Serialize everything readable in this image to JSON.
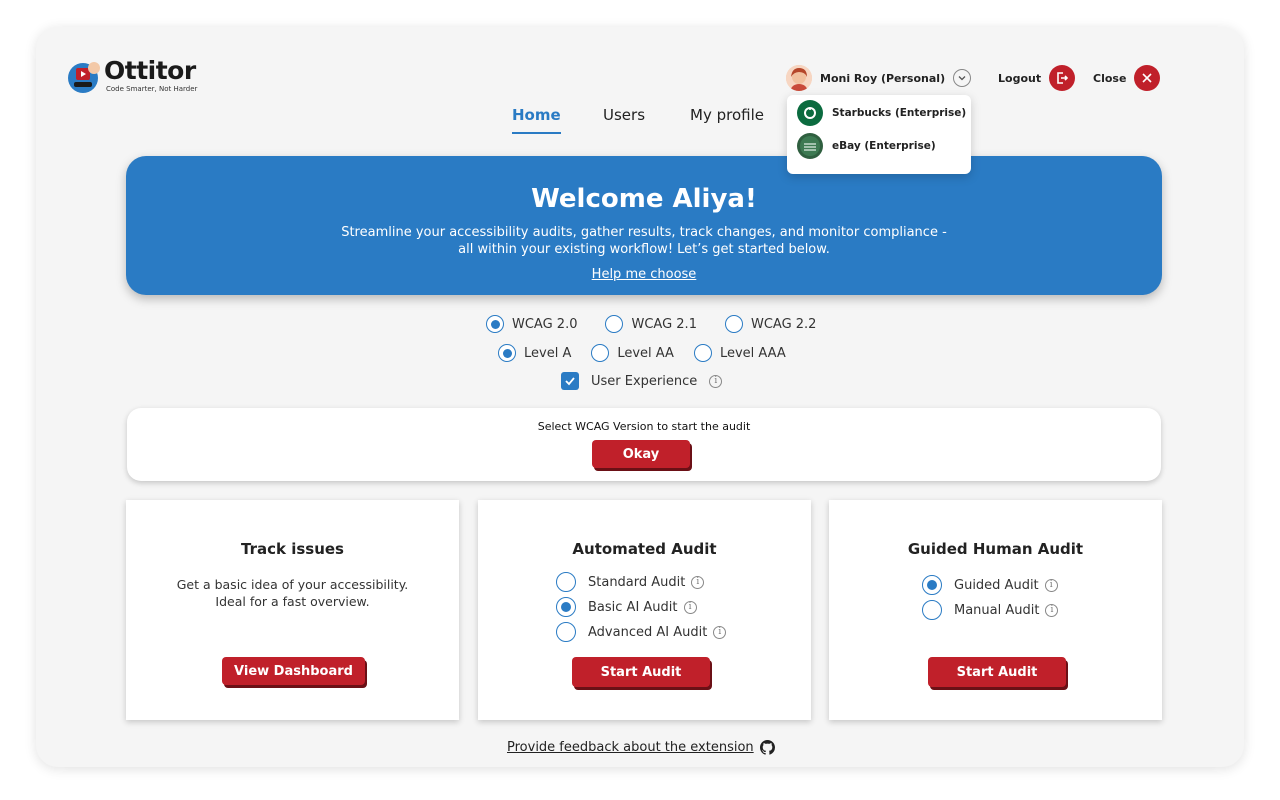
{
  "brand": {
    "name": "Ottitor",
    "tagline": "Code Smarter, Not Harder"
  },
  "header": {
    "account": {
      "name": "Moni Roy (Personal)"
    },
    "logout_label": "Logout",
    "close_label": "Close"
  },
  "nav": {
    "home": "Home",
    "users": "Users",
    "my_profile": "My profile",
    "active": "Home"
  },
  "account_dropdown": {
    "items": [
      {
        "label": "Starbucks (Enterprise)"
      },
      {
        "label": "eBay (Enterprise)"
      }
    ]
  },
  "banner": {
    "title": "Welcome Aliya!",
    "line1": "Streamline your accessibility audits, gather results, track changes, and monitor compliance -",
    "line2": "all within your existing workflow! Let’s get started below.",
    "help_link": "Help me choose"
  },
  "wcag": {
    "versions": [
      {
        "label": "WCAG 2.0",
        "selected": true
      },
      {
        "label": "WCAG 2.1",
        "selected": false
      },
      {
        "label": "WCAG 2.2",
        "selected": false
      }
    ],
    "levels": [
      {
        "label": "Level A",
        "selected": true
      },
      {
        "label": "Level AA",
        "selected": false
      },
      {
        "label": "Level AAA",
        "selected": false
      }
    ],
    "user_experience": {
      "label": "User Experience",
      "checked": true
    }
  },
  "prompt": {
    "message": "Select WCAG Version to start the audit",
    "button": "Okay"
  },
  "cards": {
    "track": {
      "title": "Track issues",
      "desc_line1": "Get a basic idea of your accessibility.",
      "desc_line2": "Ideal for a fast overview.",
      "button": "View Dashboard"
    },
    "automated": {
      "title": "Automated Audit",
      "options": [
        {
          "label": "Standard Audit",
          "selected": false
        },
        {
          "label": "Basic AI Audit",
          "selected": true
        },
        {
          "label": "Advanced AI Audit",
          "selected": false
        }
      ],
      "button": "Start Audit"
    },
    "guided": {
      "title": "Guided Human Audit",
      "options": [
        {
          "label": "Guided Audit",
          "selected": true
        },
        {
          "label": "Manual Audit",
          "selected": false
        }
      ],
      "button": "Start Audit"
    }
  },
  "footer": {
    "feedback_link": "Provide feedback about the extension"
  },
  "colors": {
    "primary_blue": "#2a7bc4",
    "accent_red": "#c0202a",
    "frame_bg": "#f5f5f5"
  },
  "icons": {
    "logout": "logout-icon",
    "close": "close-icon",
    "chevron": "chevron-down-icon",
    "info": "info-icon",
    "github": "github-icon"
  }
}
